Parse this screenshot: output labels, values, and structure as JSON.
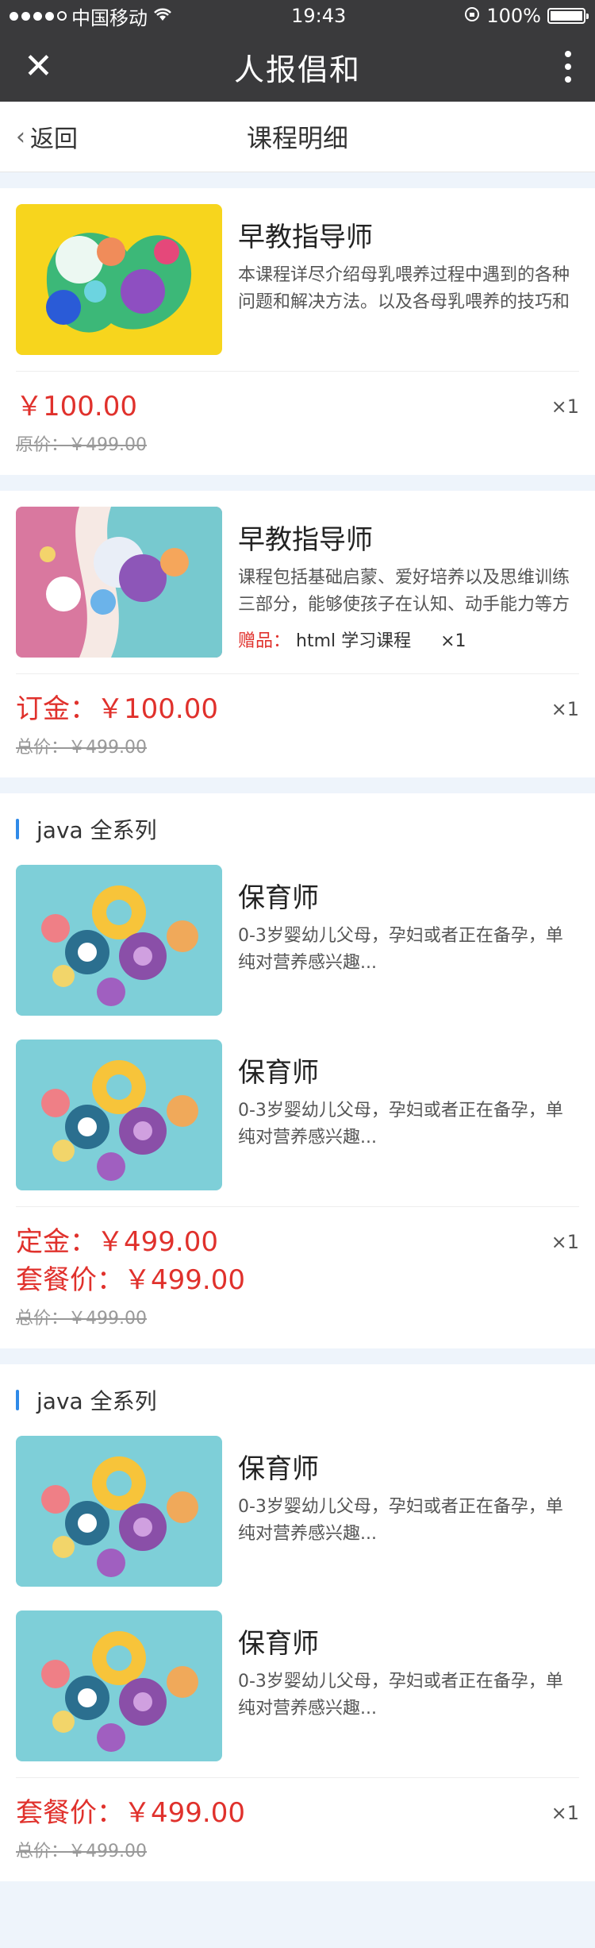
{
  "status": {
    "carrier": "中国移动",
    "time": "19:43",
    "battery": "100%"
  },
  "app": {
    "title": "人报倡和"
  },
  "nav": {
    "back": "返回",
    "title": "课程明细"
  },
  "orders": [
    {
      "items": [
        {
          "name": "早教指导师",
          "desc": "本课程详尽介绍母乳喂养过程中遇到的各种问题和解决方法。以及各母乳喂养的技巧和方法"
        }
      ],
      "price_main": "￥100.00",
      "price_old": "原价：￥499.00",
      "qty": "×1"
    },
    {
      "items": [
        {
          "name": "早教指导师",
          "desc": "课程包括基础启蒙、爱好培养以及思维训练三部分，能够使孩子在认知、动手能力等方面全面发展",
          "gift_label": "赠品：",
          "gift_text": "html 学习课程",
          "gift_qty": "×1"
        }
      ],
      "price_main": "订金：￥100.00",
      "price_old": "总价：￥499.00",
      "qty": "×1"
    },
    {
      "section": "java 全系列",
      "items": [
        {
          "name": "保育师",
          "desc": "0-3岁婴幼儿父母，孕妇或者正在备孕，单纯对营养感兴趣..."
        },
        {
          "name": "保育师",
          "desc": "0-3岁婴幼儿父母，孕妇或者正在备孕，单纯对营养感兴趣..."
        }
      ],
      "price_main": "定金：￥499.00",
      "price_main2": "套餐价：￥499.00",
      "price_old": "总价：￥499.00",
      "qty": "×1"
    },
    {
      "section": "java 全系列",
      "items": [
        {
          "name": "保育师",
          "desc": "0-3岁婴幼儿父母，孕妇或者正在备孕，单纯对营养感兴趣..."
        },
        {
          "name": "保育师",
          "desc": "0-3岁婴幼儿父母，孕妇或者正在备孕，单纯对营养感兴趣..."
        }
      ],
      "price_main": "套餐价：￥499.00",
      "price_old": "总价：￥499.00",
      "qty": "×1"
    }
  ],
  "colors": {
    "accent_red": "#e0312c",
    "section_blue": "#2f8ae8",
    "header_dark": "#3a3a3c"
  }
}
